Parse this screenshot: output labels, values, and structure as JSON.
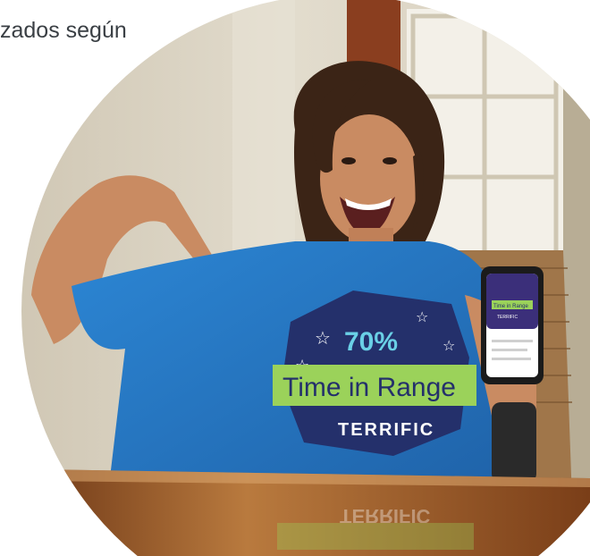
{
  "header": {
    "text": "zados según"
  },
  "shirt": {
    "percent": "70%",
    "band_label": "Time in Range",
    "sub_label": "TERRIFIC"
  },
  "phone": {
    "band_label": "Time in Range",
    "sub_label": "TERRIFIC"
  },
  "table_reflection": {
    "text": "TERRIFIC"
  },
  "colors": {
    "shirt_blue": "#2f7fc9",
    "badge_navy": "#24306b",
    "badge_green": "#9bd25a",
    "badge_percent": "#6ad0e6",
    "wall": "#d9d1c1",
    "wood": "#8a4a20"
  }
}
